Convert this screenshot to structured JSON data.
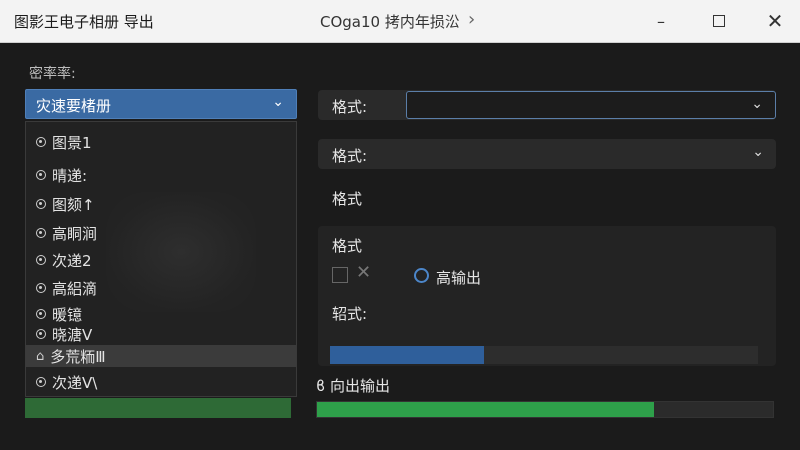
{
  "titlebar": {
    "app_title": "图影王电子相册 导出",
    "doc_title": "COga10 拷内年损㳂",
    "chevron": "›",
    "minimize": "–",
    "close": "✕"
  },
  "left": {
    "label": "密率率:",
    "select_value": "灾速要楮册",
    "select_chevron": "⌄",
    "dropdown_items": [
      {
        "label": "图景1"
      },
      {
        "label": "晴递:"
      },
      {
        "label": "图颏↑"
      },
      {
        "label": "高眮涧"
      },
      {
        "label": "次递2"
      },
      {
        "label": "高絽滴"
      },
      {
        "label": "暖镱"
      },
      {
        "label": "晓溏V"
      },
      {
        "label": "多荒粫Ⅲ",
        "selected": true,
        "icon": "home-icon"
      },
      {
        "label": "次递V\\"
      }
    ]
  },
  "right": {
    "row1_label": "格式:",
    "row1_chevron": "⌄",
    "row2_label": "格式:",
    "row2_chevron": "⌄",
    "plain_label": "格式",
    "panel": {
      "title": "格式",
      "checkbox_x": "✕",
      "radio_label": "高输出",
      "label2": "轺式:",
      "progress": 0.36
    },
    "output_label": "ϐ 向出输出",
    "output_progress": 0.74
  },
  "colors": {
    "accent_blue": "#3a6aa3",
    "progress_green": "#2ea04a",
    "progress_blue": "#2f5f9b"
  }
}
